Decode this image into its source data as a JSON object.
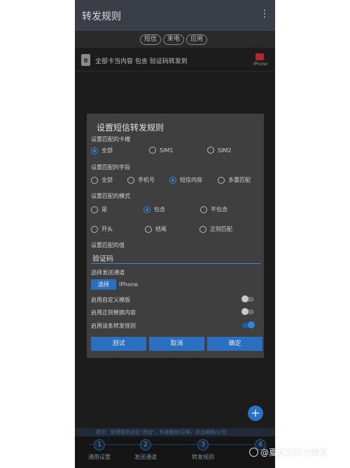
{
  "appbar": {
    "title": "转发规则",
    "menu_glyph": "⋮"
  },
  "tabs": [
    "短信",
    "来电",
    "应用"
  ],
  "rule_row": {
    "text": "全部卡当内容 包含 验证码转发到",
    "channel_label": "iPhone"
  },
  "fab_glyph": "+",
  "hint_text": "提示：新建规则点击\"添加\"，长按删除/召唤，点击编辑/公司",
  "steps": [
    {
      "num": "1",
      "label": "通用设置"
    },
    {
      "num": "2",
      "label": "发送通道"
    },
    {
      "num": "3",
      "label": "转发规则"
    },
    {
      "num": "4",
      "label": ""
    }
  ],
  "dialog": {
    "title": "设置短信转发规则",
    "sim_section": "设置匹配的卡槽",
    "sim_options": [
      "全部",
      "SIM1",
      "SIM2"
    ],
    "sim_selected": "全部",
    "field_section": "设置匹配的字段",
    "field_options": [
      "全部",
      "手机号",
      "短信内容",
      "多重匹配"
    ],
    "field_selected": "短信内容",
    "mode_section": "设置匹配的模式",
    "mode_options": [
      "是",
      "包含",
      "不包含",
      "开头",
      "结尾",
      "正则匹配"
    ],
    "mode_selected": "包含",
    "value_section": "设置匹配的值",
    "value": "验证码",
    "channel_section": "选择发送通道",
    "choose_label": "选择",
    "channel_name": "iPhone",
    "toggles": [
      {
        "label": "启用自定义模版",
        "on": false
      },
      {
        "label": "启用正则替换内容",
        "on": false
      },
      {
        "label": "启用该条转发规则",
        "on": true
      }
    ],
    "buttons": {
      "test": "测试",
      "cancel": "取消",
      "ok": "确定"
    }
  },
  "watermark": "@夏天的阳光微笑",
  "colors": {
    "accent": "#2f86d9",
    "button": "#2a6fc0",
    "appbar": "#3a3f47",
    "dialog": "#3f3f3f"
  }
}
